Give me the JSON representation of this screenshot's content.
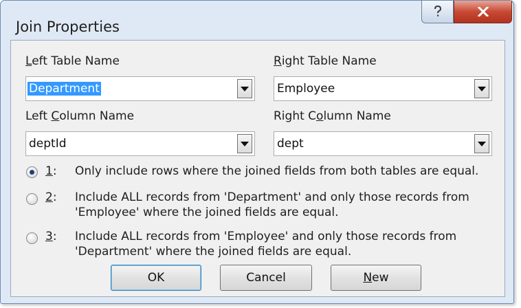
{
  "window": {
    "title": "Join Properties",
    "help_glyph": "?",
    "close_glyph": "x"
  },
  "left_table": {
    "label_prefix": "",
    "label_key": "L",
    "label_rest": "eft Table Name",
    "value": "Department"
  },
  "right_table": {
    "label_prefix": "",
    "label_key": "R",
    "label_rest": "ight Table Name",
    "value": "Employee"
  },
  "left_column": {
    "label_prefix": "Left ",
    "label_key": "C",
    "label_rest": "olumn Name",
    "value": "deptId"
  },
  "right_column": {
    "label_prefix": "Right C",
    "label_key": "o",
    "label_rest": "lumn Name",
    "value": "dept"
  },
  "options": [
    {
      "key": "1",
      "suffix": ":",
      "selected": true,
      "line1": "Only include rows where the joined fields from both tables are equal.",
      "line2": ""
    },
    {
      "key": "2",
      "suffix": ":",
      "selected": false,
      "line1": "Include ALL records from 'Department' and only those records from",
      "line2": "'Employee' where the joined fields are equal."
    },
    {
      "key": "3",
      "suffix": ":",
      "selected": false,
      "line1": "Include ALL records from 'Employee' and only those records from",
      "line2": "'Department' where the joined fields are equal."
    }
  ],
  "buttons": {
    "ok": "OK",
    "cancel": "Cancel",
    "new_key": "N",
    "new_rest": "ew"
  },
  "icons": {
    "help": "help-icon",
    "close": "close-icon",
    "dropdown": "chevron-down-icon"
  },
  "colors": {
    "selection": "#3399ff",
    "close_button": "#c74a35",
    "frame": "#dfe9f5"
  }
}
